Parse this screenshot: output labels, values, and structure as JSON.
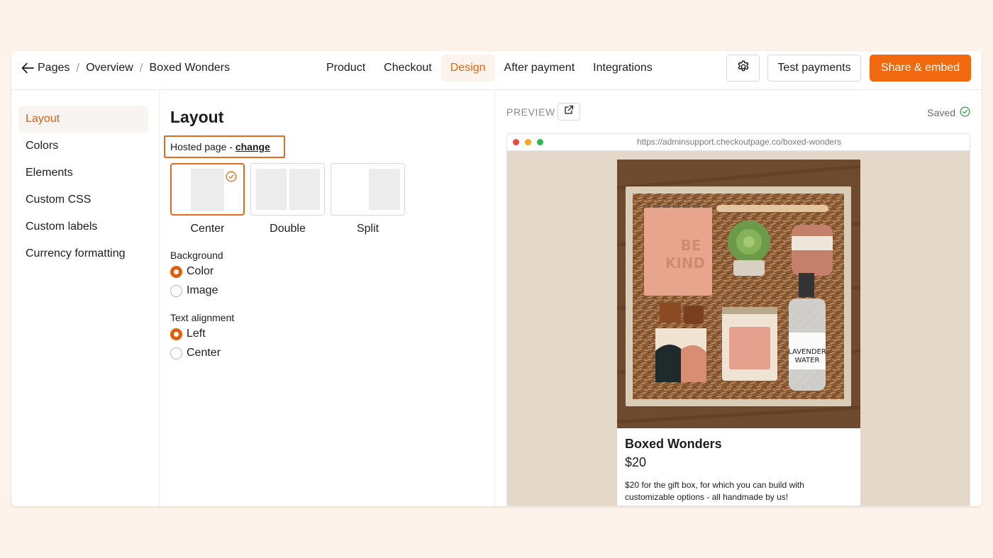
{
  "breadcrumb": {
    "items": [
      "Pages",
      "Overview",
      "Boxed Wonders"
    ],
    "separator": "/"
  },
  "nav": {
    "tabs": [
      "Product",
      "Checkout",
      "Design",
      "After payment",
      "Integrations"
    ],
    "active": "Design"
  },
  "actions": {
    "test_payments": "Test payments",
    "share_embed": "Share & embed"
  },
  "sidebar": {
    "items": [
      "Layout",
      "Colors",
      "Elements",
      "Custom CSS",
      "Custom labels",
      "Currency formatting"
    ],
    "active": "Layout"
  },
  "layout_panel": {
    "title": "Layout",
    "hosted_text": "Hosted page - ",
    "change_link": "change",
    "options": [
      "Center",
      "Double",
      "Split"
    ],
    "selected_option": "Center",
    "background": {
      "label": "Background",
      "options": [
        "Color",
        "Image"
      ],
      "selected": "Color"
    },
    "text_alignment": {
      "label": "Text alignment",
      "options": [
        "Left",
        "Center"
      ],
      "selected": "Left"
    }
  },
  "preview": {
    "title": "PREVIEW",
    "status": "Saved",
    "url": "https://adminsupport.checkoutpage.co/boxed-wonders",
    "product": {
      "name": "Boxed Wonders",
      "price": "$20",
      "description": "$20 for the gift box, for which you can build with customizable options - all handmade by us!",
      "notebook_text_1": "BE",
      "notebook_text_2": "KIND",
      "spray_label_1": "LAVENDER",
      "spray_label_2": "WATER"
    }
  },
  "colors": {
    "accent": "#f0690f",
    "active_text": "#e0600d",
    "preview_bg": "#e4d8cb",
    "page_bg": "#fdf3ea"
  }
}
